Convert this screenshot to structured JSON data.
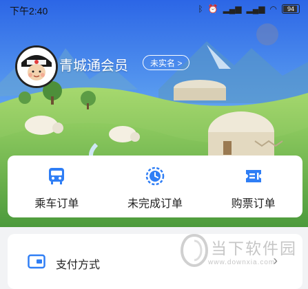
{
  "status_bar": {
    "time": "下午2:40",
    "icons": [
      "bluetooth-icon",
      "alarm-icon",
      "hd-signal-icon",
      "signal-icon",
      "wifi-icon"
    ],
    "battery_level": "94"
  },
  "profile": {
    "username": "青城通会员",
    "auth_badge": "未实名 >"
  },
  "orders": {
    "items": [
      {
        "label": "乘车订单",
        "icon": "bus-icon"
      },
      {
        "label": "未完成订单",
        "icon": "clock-icon"
      },
      {
        "label": "购票订单",
        "icon": "ticket-icon"
      }
    ]
  },
  "menu": {
    "payment_label": "支付方式",
    "payment_icon": "wallet-icon"
  },
  "watermark": {
    "title": "当下软件园",
    "url": "www.downxia.com"
  },
  "colors": {
    "accent": "#2f7ef5",
    "sky_top": "#2c66e6",
    "grass": "#79c25a"
  }
}
